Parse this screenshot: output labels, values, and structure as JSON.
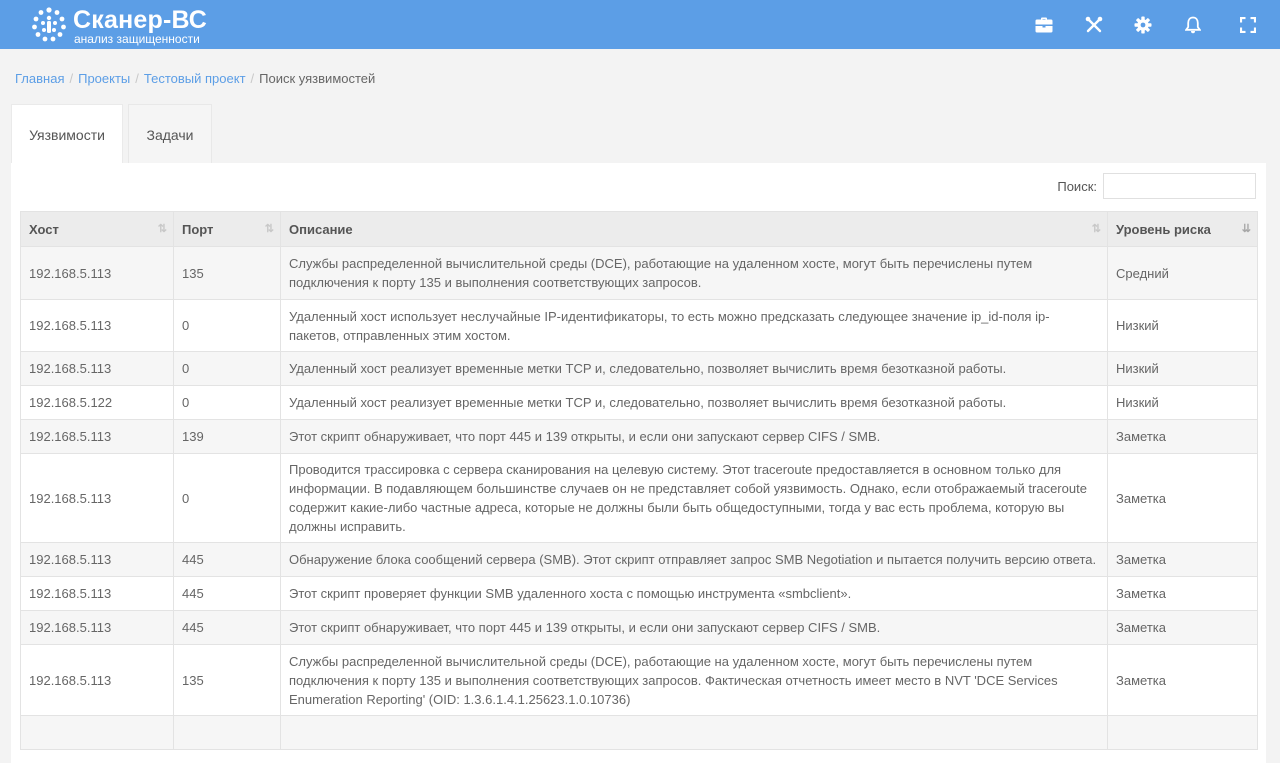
{
  "app": {
    "title": "Сканер-ВС",
    "subtitle": "анализ защищенности"
  },
  "toolbar": {
    "icons": [
      "briefcase-icon",
      "tools-icon",
      "gear-icon",
      "bell-icon",
      "fullscreen-icon"
    ]
  },
  "breadcrumb": [
    "Главная",
    "Проекты",
    "Тестовый проект",
    "Поиск уязвимостей"
  ],
  "tabs": [
    {
      "label": "Уязвимости",
      "active": true
    },
    {
      "label": "Задачи",
      "active": false
    }
  ],
  "search": {
    "label": "Поиск:",
    "value": ""
  },
  "table": {
    "columns": [
      "Хост",
      "Порт",
      "Описание",
      "Уровень риска"
    ],
    "rows": [
      {
        "host": "192.168.5.113",
        "port": "135",
        "description": "Службы распределенной вычислительной среды (DCE), работающие на удаленном хосте, могут быть перечислены путем подключения к порту 135 и выполнения соответствующих запросов.",
        "risk": "Средний"
      },
      {
        "host": "192.168.5.113",
        "port": "0",
        "description": "Удаленный хост использует неслучайные IP-идентификаторы, то есть можно предсказать следующее значение ip_id-поля ip-пакетов, отправленных этим хостом.",
        "risk": "Низкий"
      },
      {
        "host": "192.168.5.113",
        "port": "0",
        "description": "Удаленный хост реализует временные метки TCP и, следовательно, позволяет вычислить время безотказной работы.",
        "risk": "Низкий"
      },
      {
        "host": "192.168.5.122",
        "port": "0",
        "description": "Удаленный хост реализует временные метки TCP и, следовательно, позволяет вычислить время безотказной работы.",
        "risk": "Низкий"
      },
      {
        "host": "192.168.5.113",
        "port": "139",
        "description": "Этот скрипт обнаруживает, что порт 445 и 139 открыты, и если они запускают сервер CIFS / SMB.",
        "risk": "Заметка"
      },
      {
        "host": "192.168.5.113",
        "port": "0",
        "description": "Проводится трассировка с сервера сканирования на целевую систему. Этот traceroute предоставляется в основном только для информации. В подавляющем большинстве случаев он не представляет собой уязвимость. Однако, если отображаемый traceroute содержит какие-либо частные адреса, которые не должны были быть общедоступными, тогда у вас есть проблема, которую вы должны исправить.",
        "risk": "Заметка"
      },
      {
        "host": "192.168.5.113",
        "port": "445",
        "description": "Обнаружение блока сообщений сервера (SMB). Этот скрипт отправляет запрос SMB Negotiation и пытается получить версию ответа.",
        "risk": "Заметка"
      },
      {
        "host": "192.168.5.113",
        "port": "445",
        "description": "Этот скрипт проверяет функции SMB удаленного хоста с помощью инструмента «smbclient».",
        "risk": "Заметка"
      },
      {
        "host": "192.168.5.113",
        "port": "445",
        "description": "Этот скрипт обнаруживает, что порт 445 и 139 открыты, и если они запускают сервер CIFS / SMB.",
        "risk": "Заметка"
      },
      {
        "host": "192.168.5.113",
        "port": "135",
        "description": "Службы распределенной вычислительной среды (DCE), работающие на удаленном хосте, могут быть перечислены путем подключения к порту 135 и выполнения соответствующих запросов. Фактическая отчетность имеет место в NVT 'DCE Services Enumeration Reporting' (OID: 1.3.6.1.4.1.25623.1.0.10736)",
        "risk": "Заметка"
      },
      {
        "host": "",
        "port": "",
        "description": "",
        "risk": ""
      }
    ]
  },
  "colors": {
    "header": "#5c9ee6",
    "link": "#5c9ee6",
    "row_alt": "#f6f6f6",
    "header_cell": "#ececec"
  }
}
